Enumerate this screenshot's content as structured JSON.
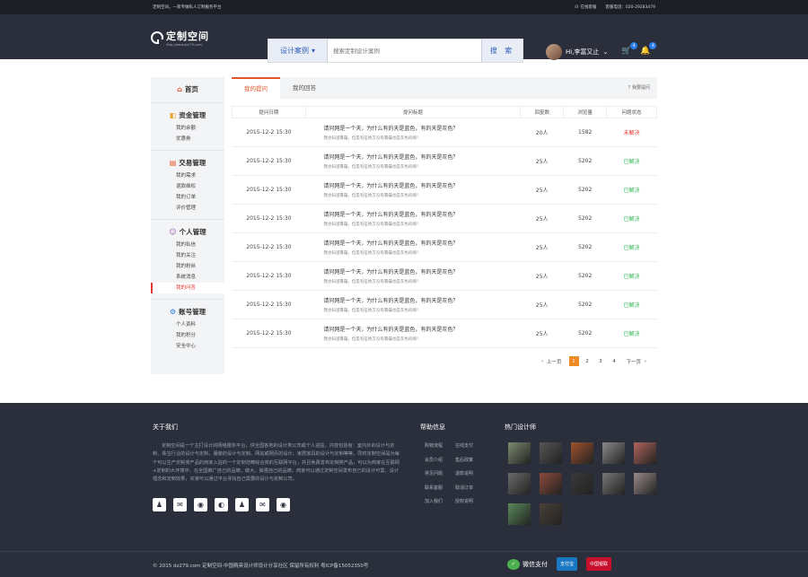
{
  "topbar": {
    "slogan": "定制空间，一家专做私人订制服务平台",
    "service_label": "在线客服",
    "hotline": "客服电话：020-29283479"
  },
  "header": {
    "logo_name": "定制空间",
    "logo_url": "http://www.dz279.com/",
    "search_category": "设计案例",
    "search_placeholder": "搜索定制设计案例",
    "search_button": "搜 索",
    "user_name": "Hi,李富又止",
    "cart_badge": "4",
    "notice_badge": "4"
  },
  "sidebar": {
    "sections": [
      {
        "title": "首页",
        "icon": "home-icon",
        "items": []
      },
      {
        "title": "资金管理",
        "icon": "coins-icon",
        "items": [
          "我的余额",
          "优惠券"
        ]
      },
      {
        "title": "交易管理",
        "icon": "document-icon",
        "items": [
          "我的需求",
          "退款维权",
          "我的订单",
          "评价管理"
        ]
      },
      {
        "title": "个人管理",
        "icon": "user-icon",
        "items": [
          "我的私信",
          "我的关注",
          "我的粉丝",
          "系统消息",
          "我的问答"
        ]
      },
      {
        "title": "账号管理",
        "icon": "gear-icon",
        "items": [
          "个人资料",
          "我的积分",
          "安全中心"
        ]
      }
    ],
    "active_item": "我的问答"
  },
  "main": {
    "tabs": [
      "我的提问",
      "我的回答"
    ],
    "active_tab": "我的提问",
    "ask_link": "我要提问",
    "columns": [
      "提问日期",
      "提问标题",
      "回复数",
      "浏览量",
      "问题状态"
    ],
    "rows": [
      {
        "date": "2015-12-2 15:30",
        "title": "请问网是一个天，为什么有的天是蓝色，有的天是灰色？",
        "sub": "我也知道雾霾，但是有些地方没有雾霾也是灰色的啊！",
        "replies": "20人",
        "views": "1582",
        "status": "未解决",
        "solved": false
      },
      {
        "date": "2015-12-2 15:30",
        "title": "请问网是一个天，为什么有的天是蓝色，有的天是灰色？",
        "sub": "我也知道雾霾，但是有些地方没有雾霾也是灰色的啊！",
        "replies": "25人",
        "views": "5202",
        "status": "已解决",
        "solved": true
      },
      {
        "date": "2015-12-2 15:30",
        "title": "请问网是一个天，为什么有的天是蓝色，有的天是灰色？",
        "sub": "我也知道雾霾，但是有些地方没有雾霾也是灰色的啊！",
        "replies": "25人",
        "views": "5202",
        "status": "已解决",
        "solved": true
      },
      {
        "date": "2015-12-2 15:30",
        "title": "请问网是一个天，为什么有的天是蓝色，有的天是灰色？",
        "sub": "我也知道雾霾，但是有些地方没有雾霾也是灰色的啊！",
        "replies": "25人",
        "views": "5202",
        "status": "已解决",
        "solved": true
      },
      {
        "date": "2015-12-2 15:30",
        "title": "请问网是一个天，为什么有的天是蓝色，有的天是灰色？",
        "sub": "我也知道雾霾，但是有些地方没有雾霾也是灰色的啊！",
        "replies": "25人",
        "views": "5202",
        "status": "已解决",
        "solved": true
      },
      {
        "date": "2015-12-2 15:30",
        "title": "请问网是一个天，为什么有的天是蓝色，有的天是灰色？",
        "sub": "我也知道雾霾，但是有些地方没有雾霾也是灰色的啊！",
        "replies": "25人",
        "views": "5202",
        "status": "已解决",
        "solved": true
      },
      {
        "date": "2015-12-2 15:30",
        "title": "请问网是一个天，为什么有的天是蓝色，有的天是灰色？",
        "sub": "我也知道雾霾，但是有些地方没有雾霾也是灰色的啊！",
        "replies": "25人",
        "views": "5202",
        "status": "已解决",
        "solved": true
      },
      {
        "date": "2015-12-2 15:30",
        "title": "请问网是一个天，为什么有的天是蓝色，有的天是灰色？",
        "sub": "我也知道雾霾，但是有些地方没有雾霾也是灰色的啊！",
        "replies": "25人",
        "views": "5202",
        "status": "已解决",
        "solved": true
      }
    ],
    "pager": {
      "prev": "上一页",
      "pages": [
        "1",
        "2",
        "3",
        "4"
      ],
      "current": "1",
      "next": "下一页"
    }
  },
  "footer": {
    "about_title": "关于我们",
    "about_text": "定制空间是一个主打设计的网络服务平台，供全国各地的设计类公司或个人进驻，内容包括有：室内外的设计与定制、珠宝行业的设计与定制、服装的设计与定制、网站或网页的设计、家居家具的设计与定制等等。同时定制空间是为每个可以生产定制类产品的商家入驻的一个定制范畴综合类的互联网平台，并且免费发布定制类产品，可以为商家在互联网+定制的大环境中，在全国推广自己的品牌。做大，做强自己的品牌。商家可以通过定制空间发布自己的设计可需，设计理念和定制效果，买家可以通过平台寻找自己需要的设计与定制公司。",
    "socials": [
      "qq-icon",
      "wechat-icon",
      "weibo-icon",
      "tencent-weibo-icon",
      "qq-icon",
      "wechat-icon",
      "weibo-icon"
    ],
    "help_title": "帮助信息",
    "help_links": [
      "购物流程",
      "在线支付",
      "会员介绍",
      "售后政策",
      "常见问题",
      "退款说明",
      "联系客服",
      "取消订单",
      "加入我们",
      "授权说明"
    ],
    "designers_title": "热门设计师",
    "designer_colors": [
      "#7d8a6e",
      "#555555",
      "#a0522d",
      "#8a8a8a",
      "#b0645a",
      "#6b6b6b",
      "#8b4a3a",
      "#3a3a3a",
      "#777777",
      "#9a8a8a",
      "#5a8a5a",
      "#4a4038"
    ],
    "copyright": "© 2015 dz279.com 定制空间-中国精英设计师设计分享社区 保留所有权利 粤ICP备15052350号",
    "pay_wechat": "微信支付",
    "pay_alipay": "支付宝",
    "pay_unionpay": "中国银联"
  }
}
